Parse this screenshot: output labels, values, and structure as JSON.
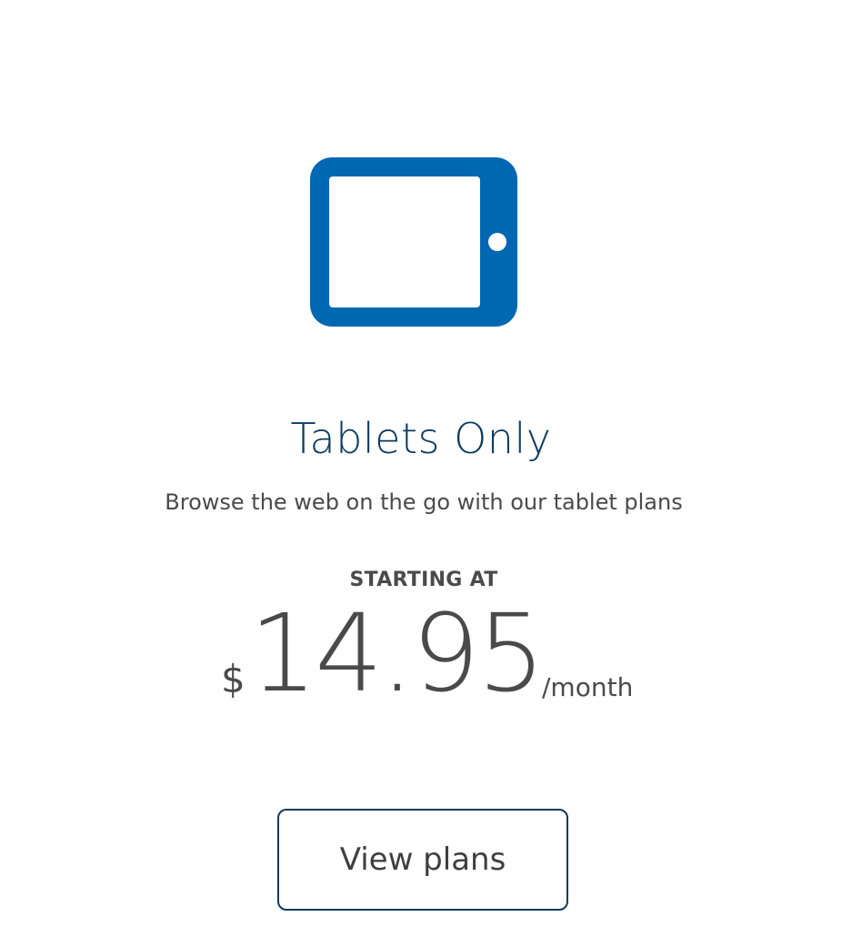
{
  "card": {
    "icon": "tablet-icon",
    "title": "Tablets Only",
    "subtitle": "Browse the web on the go with our tablet plans",
    "price_label": "STARTING AT",
    "currency": "$",
    "price": "14.95",
    "period": "/month",
    "cta_label": "View plans"
  },
  "colors": {
    "brand_blue": "#0067b3",
    "title_navy": "#0d3a5e",
    "text_gray": "#4a4a4a"
  }
}
